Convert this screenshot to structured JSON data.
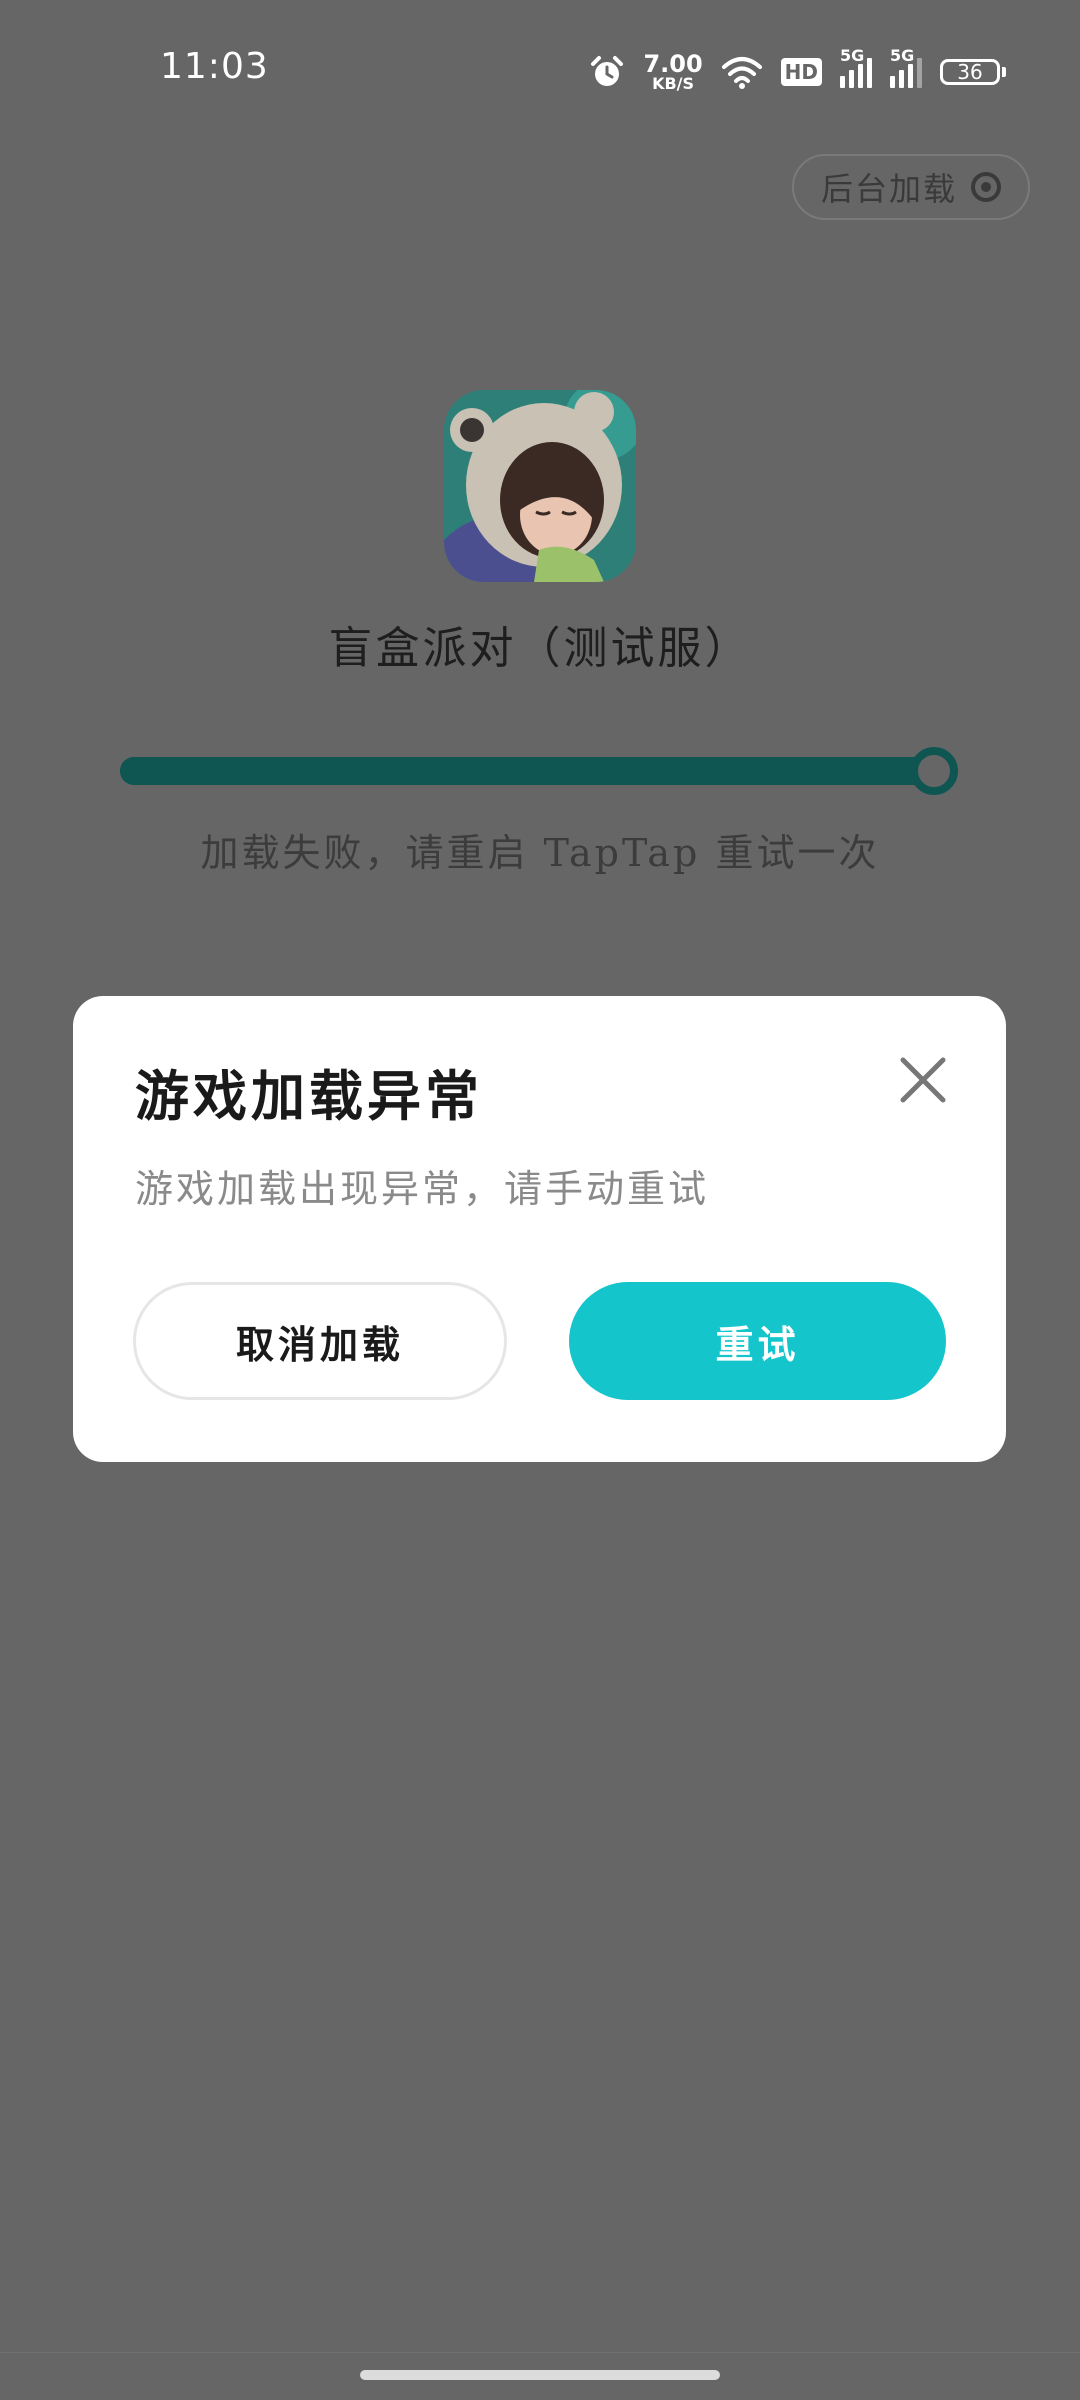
{
  "status_bar": {
    "time": "11:03",
    "net_speed_value": "7.00",
    "net_speed_unit": "KB/S",
    "hd_label": "HD",
    "signal_1_label": "5G",
    "signal_2_label": "5G",
    "battery_level": "36",
    "icons": [
      "alarm-icon",
      "wifi-icon",
      "hd-icon",
      "signal-icon",
      "signal-icon",
      "battery-icon"
    ]
  },
  "background_load": {
    "label": "后台加载",
    "icon": "target-icon"
  },
  "game": {
    "title": "盲盒派对（测试服）",
    "progress": 1.0,
    "status_message": "加载失败，请重启 TapTap 重试一次"
  },
  "dialog": {
    "title": "游戏加载异常",
    "message": "游戏加载出现异常，请手动重试",
    "cancel_label": "取消加载",
    "retry_label": "重试",
    "close_icon": "close-icon"
  },
  "colors": {
    "overlay": "#666666",
    "accent": "#14c5cc",
    "progress": "#0f5653"
  }
}
